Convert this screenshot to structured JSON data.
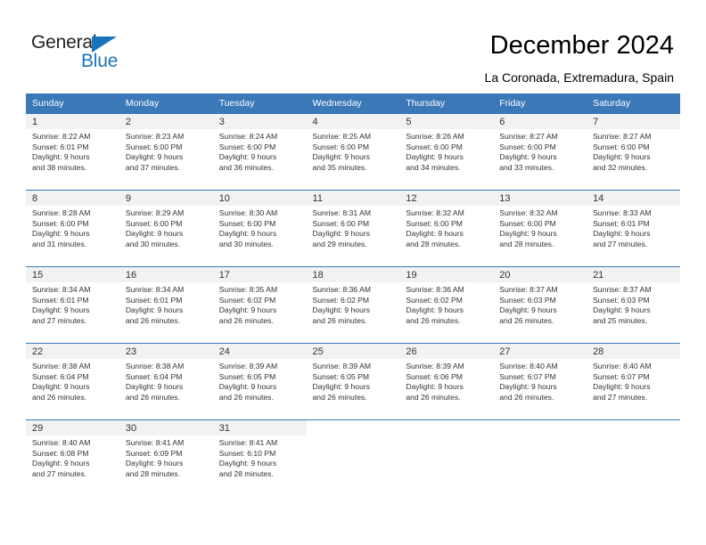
{
  "brand": {
    "name_part1": "General",
    "name_part2": "Blue",
    "accent_color": "#1a74bb"
  },
  "header": {
    "title": "December 2024",
    "subtitle": "La Coronada, Extremadura, Spain"
  },
  "calendar": {
    "header_bg": "#3b78b8",
    "daynum_bg": "#f2f2f2",
    "weekday_headers": [
      "Sunday",
      "Monday",
      "Tuesday",
      "Wednesday",
      "Thursday",
      "Friday",
      "Saturday"
    ],
    "weeks": [
      [
        {
          "day": "1",
          "sunrise": "Sunrise: 8:22 AM",
          "sunset": "Sunset: 6:01 PM",
          "daylight1": "Daylight: 9 hours",
          "daylight2": "and 38 minutes."
        },
        {
          "day": "2",
          "sunrise": "Sunrise: 8:23 AM",
          "sunset": "Sunset: 6:00 PM",
          "daylight1": "Daylight: 9 hours",
          "daylight2": "and 37 minutes."
        },
        {
          "day": "3",
          "sunrise": "Sunrise: 8:24 AM",
          "sunset": "Sunset: 6:00 PM",
          "daylight1": "Daylight: 9 hours",
          "daylight2": "and 36 minutes."
        },
        {
          "day": "4",
          "sunrise": "Sunrise: 8:25 AM",
          "sunset": "Sunset: 6:00 PM",
          "daylight1": "Daylight: 9 hours",
          "daylight2": "and 35 minutes."
        },
        {
          "day": "5",
          "sunrise": "Sunrise: 8:26 AM",
          "sunset": "Sunset: 6:00 PM",
          "daylight1": "Daylight: 9 hours",
          "daylight2": "and 34 minutes."
        },
        {
          "day": "6",
          "sunrise": "Sunrise: 8:27 AM",
          "sunset": "Sunset: 6:00 PM",
          "daylight1": "Daylight: 9 hours",
          "daylight2": "and 33 minutes."
        },
        {
          "day": "7",
          "sunrise": "Sunrise: 8:27 AM",
          "sunset": "Sunset: 6:00 PM",
          "daylight1": "Daylight: 9 hours",
          "daylight2": "and 32 minutes."
        }
      ],
      [
        {
          "day": "8",
          "sunrise": "Sunrise: 8:28 AM",
          "sunset": "Sunset: 6:00 PM",
          "daylight1": "Daylight: 9 hours",
          "daylight2": "and 31 minutes."
        },
        {
          "day": "9",
          "sunrise": "Sunrise: 8:29 AM",
          "sunset": "Sunset: 6:00 PM",
          "daylight1": "Daylight: 9 hours",
          "daylight2": "and 30 minutes."
        },
        {
          "day": "10",
          "sunrise": "Sunrise: 8:30 AM",
          "sunset": "Sunset: 6:00 PM",
          "daylight1": "Daylight: 9 hours",
          "daylight2": "and 30 minutes."
        },
        {
          "day": "11",
          "sunrise": "Sunrise: 8:31 AM",
          "sunset": "Sunset: 6:00 PM",
          "daylight1": "Daylight: 9 hours",
          "daylight2": "and 29 minutes."
        },
        {
          "day": "12",
          "sunrise": "Sunrise: 8:32 AM",
          "sunset": "Sunset: 6:00 PM",
          "daylight1": "Daylight: 9 hours",
          "daylight2": "and 28 minutes."
        },
        {
          "day": "13",
          "sunrise": "Sunrise: 8:32 AM",
          "sunset": "Sunset: 6:00 PM",
          "daylight1": "Daylight: 9 hours",
          "daylight2": "and 28 minutes."
        },
        {
          "day": "14",
          "sunrise": "Sunrise: 8:33 AM",
          "sunset": "Sunset: 6:01 PM",
          "daylight1": "Daylight: 9 hours",
          "daylight2": "and 27 minutes."
        }
      ],
      [
        {
          "day": "15",
          "sunrise": "Sunrise: 8:34 AM",
          "sunset": "Sunset: 6:01 PM",
          "daylight1": "Daylight: 9 hours",
          "daylight2": "and 27 minutes."
        },
        {
          "day": "16",
          "sunrise": "Sunrise: 8:34 AM",
          "sunset": "Sunset: 6:01 PM",
          "daylight1": "Daylight: 9 hours",
          "daylight2": "and 26 minutes."
        },
        {
          "day": "17",
          "sunrise": "Sunrise: 8:35 AM",
          "sunset": "Sunset: 6:02 PM",
          "daylight1": "Daylight: 9 hours",
          "daylight2": "and 26 minutes."
        },
        {
          "day": "18",
          "sunrise": "Sunrise: 8:36 AM",
          "sunset": "Sunset: 6:02 PM",
          "daylight1": "Daylight: 9 hours",
          "daylight2": "and 26 minutes."
        },
        {
          "day": "19",
          "sunrise": "Sunrise: 8:36 AM",
          "sunset": "Sunset: 6:02 PM",
          "daylight1": "Daylight: 9 hours",
          "daylight2": "and 26 minutes."
        },
        {
          "day": "20",
          "sunrise": "Sunrise: 8:37 AM",
          "sunset": "Sunset: 6:03 PM",
          "daylight1": "Daylight: 9 hours",
          "daylight2": "and 26 minutes."
        },
        {
          "day": "21",
          "sunrise": "Sunrise: 8:37 AM",
          "sunset": "Sunset: 6:03 PM",
          "daylight1": "Daylight: 9 hours",
          "daylight2": "and 25 minutes."
        }
      ],
      [
        {
          "day": "22",
          "sunrise": "Sunrise: 8:38 AM",
          "sunset": "Sunset: 6:04 PM",
          "daylight1": "Daylight: 9 hours",
          "daylight2": "and 26 minutes."
        },
        {
          "day": "23",
          "sunrise": "Sunrise: 8:38 AM",
          "sunset": "Sunset: 6:04 PM",
          "daylight1": "Daylight: 9 hours",
          "daylight2": "and 26 minutes."
        },
        {
          "day": "24",
          "sunrise": "Sunrise: 8:39 AM",
          "sunset": "Sunset: 6:05 PM",
          "daylight1": "Daylight: 9 hours",
          "daylight2": "and 26 minutes."
        },
        {
          "day": "25",
          "sunrise": "Sunrise: 8:39 AM",
          "sunset": "Sunset: 6:05 PM",
          "daylight1": "Daylight: 9 hours",
          "daylight2": "and 26 minutes."
        },
        {
          "day": "26",
          "sunrise": "Sunrise: 8:39 AM",
          "sunset": "Sunset: 6:06 PM",
          "daylight1": "Daylight: 9 hours",
          "daylight2": "and 26 minutes."
        },
        {
          "day": "27",
          "sunrise": "Sunrise: 8:40 AM",
          "sunset": "Sunset: 6:07 PM",
          "daylight1": "Daylight: 9 hours",
          "daylight2": "and 26 minutes."
        },
        {
          "day": "28",
          "sunrise": "Sunrise: 8:40 AM",
          "sunset": "Sunset: 6:07 PM",
          "daylight1": "Daylight: 9 hours",
          "daylight2": "and 27 minutes."
        }
      ],
      [
        {
          "day": "29",
          "sunrise": "Sunrise: 8:40 AM",
          "sunset": "Sunset: 6:08 PM",
          "daylight1": "Daylight: 9 hours",
          "daylight2": "and 27 minutes."
        },
        {
          "day": "30",
          "sunrise": "Sunrise: 8:41 AM",
          "sunset": "Sunset: 6:09 PM",
          "daylight1": "Daylight: 9 hours",
          "daylight2": "and 28 minutes."
        },
        {
          "day": "31",
          "sunrise": "Sunrise: 8:41 AM",
          "sunset": "Sunset: 6:10 PM",
          "daylight1": "Daylight: 9 hours",
          "daylight2": "and 28 minutes."
        },
        {
          "day": "",
          "sunrise": "",
          "sunset": "",
          "daylight1": "",
          "daylight2": ""
        },
        {
          "day": "",
          "sunrise": "",
          "sunset": "",
          "daylight1": "",
          "daylight2": ""
        },
        {
          "day": "",
          "sunrise": "",
          "sunset": "",
          "daylight1": "",
          "daylight2": ""
        },
        {
          "day": "",
          "sunrise": "",
          "sunset": "",
          "daylight1": "",
          "daylight2": ""
        }
      ]
    ]
  }
}
